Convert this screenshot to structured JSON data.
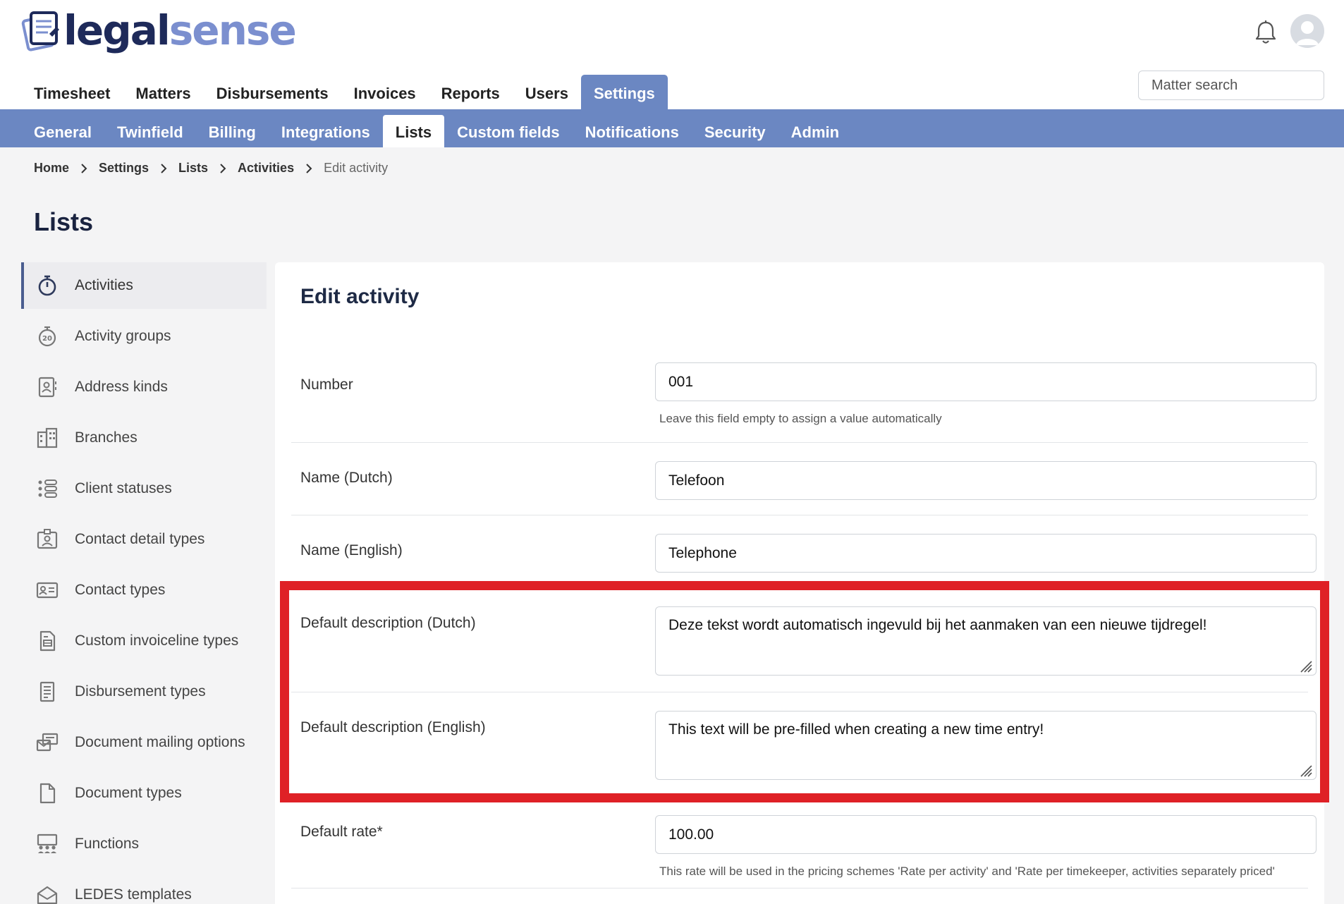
{
  "app": {
    "logo_part1": "legal",
    "logo_part2": "sense",
    "search_placeholder": "Matter search"
  },
  "main_nav": [
    {
      "label": "Timesheet"
    },
    {
      "label": "Matters"
    },
    {
      "label": "Disbursements"
    },
    {
      "label": "Invoices"
    },
    {
      "label": "Reports"
    },
    {
      "label": "Users"
    },
    {
      "label": "Settings",
      "active": true
    }
  ],
  "sub_nav": [
    {
      "label": "General"
    },
    {
      "label": "Twinfield"
    },
    {
      "label": "Billing"
    },
    {
      "label": "Integrations"
    },
    {
      "label": "Lists",
      "active": true
    },
    {
      "label": "Custom fields"
    },
    {
      "label": "Notifications"
    },
    {
      "label": "Security"
    },
    {
      "label": "Admin"
    }
  ],
  "breadcrumb": [
    {
      "label": "Home"
    },
    {
      "label": "Settings"
    },
    {
      "label": "Lists"
    },
    {
      "label": "Activities"
    },
    {
      "label": "Edit activity"
    }
  ],
  "page_title": "Lists",
  "sidebar": [
    {
      "label": "Activities",
      "icon": "stopwatch-icon",
      "active": true
    },
    {
      "label": "Activity groups",
      "icon": "stopwatch-group-icon"
    },
    {
      "label": "Address kinds",
      "icon": "address-book-icon"
    },
    {
      "label": "Branches",
      "icon": "buildings-icon"
    },
    {
      "label": "Client statuses",
      "icon": "status-list-icon"
    },
    {
      "label": "Contact detail types",
      "icon": "contact-badge-icon"
    },
    {
      "label": "Contact types",
      "icon": "id-card-icon"
    },
    {
      "label": "Custom invoiceline types",
      "icon": "invoice-line-icon"
    },
    {
      "label": "Disbursement types",
      "icon": "receipt-icon"
    },
    {
      "label": "Document mailing options",
      "icon": "mailing-icon"
    },
    {
      "label": "Document types",
      "icon": "document-icon"
    },
    {
      "label": "Functions",
      "icon": "people-group-icon"
    },
    {
      "label": "LEDES templates",
      "icon": "envelope-icon"
    }
  ],
  "form": {
    "title": "Edit activity",
    "number": {
      "label": "Number",
      "value": "001",
      "hint": "Leave this field empty to assign a value automatically"
    },
    "name_dutch": {
      "label": "Name (Dutch)",
      "value": "Telefoon"
    },
    "name_english": {
      "label": "Name (English)",
      "value": "Telephone"
    },
    "desc_dutch": {
      "label": "Default description (Dutch)",
      "value": "Deze tekst wordt automatisch ingevuld bij het aanmaken van een nieuwe tijdregel!"
    },
    "desc_english": {
      "label": "Default description (English)",
      "value": "This text will be pre-filled when creating a new time entry!"
    },
    "default_rate": {
      "label": "Default rate*",
      "value": "100.00",
      "hint": "This rate will be used in the pricing schemes 'Rate per activity' and 'Rate per timekeeper, activities separately priced'"
    }
  },
  "colors": {
    "nav_blue": "#6b87c2",
    "highlight_red": "#df2126",
    "logo_dark": "#1e2a5a",
    "logo_light": "#7b8fcf"
  }
}
